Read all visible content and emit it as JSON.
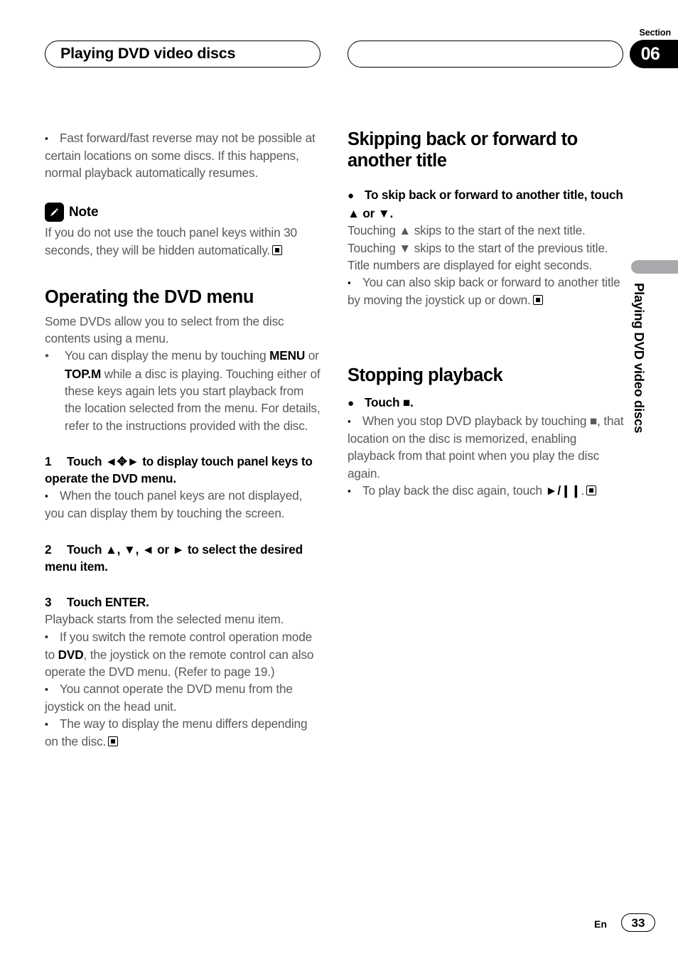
{
  "header": {
    "left_title": "Playing DVD video discs",
    "section_label": "Section",
    "section_number": "06"
  },
  "sidebar": {
    "vertical_title": "Playing DVD video discs"
  },
  "footer": {
    "language": "En",
    "page_number": "33"
  },
  "left_column": {
    "intro_note": {
      "marker": "▪",
      "text": "Fast forward/fast reverse may not be possible at certain locations on some discs. If this happens, normal playback automatically resumes."
    },
    "note_block": {
      "icon": "pencil-icon",
      "title": "Note",
      "text": "If you do not use the touch panel keys within 30 seconds, they will be hidden automatically."
    },
    "heading": "Operating the DVD menu",
    "intro": "Some DVDs allow you to select from the disc contents using a menu.",
    "bullet": {
      "marker": "•",
      "part1": "You can display the menu by touching ",
      "key1": "MENU",
      "conj": " or ",
      "key2": "TOP.M",
      "part2": " while a disc is playing. Touching either of these keys again lets you start playback from the location selected from the menu. For details, refer to the instructions provided with the disc."
    },
    "step1": {
      "number": "1",
      "text_before": "Touch ",
      "glyph": "◄✥►",
      "text_after": " to display touch panel keys to operate the DVD menu."
    },
    "step1_note": {
      "marker": "▪",
      "text": "When the touch panel keys are not displayed, you can display them by touching the screen."
    },
    "step2": {
      "number": "2",
      "text": "Touch ▲, ▼, ◄ or ► to select the desired menu item."
    },
    "step3": {
      "number": "3",
      "text": "Touch ENTER."
    },
    "step3_body": "Playback starts from the selected menu item.",
    "step3_note1": {
      "marker": "▪",
      "part1": "If you switch the remote control operation mode to ",
      "key": "DVD",
      "part2": ", the joystick on the remote control can also operate the DVD menu. (Refer to page 19.)"
    },
    "step3_note2": {
      "marker": "▪",
      "text": "You cannot operate the DVD menu from the joystick on the head unit."
    },
    "step3_note3": {
      "marker": "▪",
      "text": "The way to display the menu differs depending on the disc."
    }
  },
  "right_column": {
    "heading1": "Skipping back or forward to another title",
    "dot1": {
      "marker": "●",
      "text": "To skip back or forward to another title, touch ▲ or ▼."
    },
    "body1": "Touching ▲ skips to the start of the next title. Touching ▼ skips to the start of the previous title.",
    "body2": "Title numbers are displayed for eight seconds.",
    "note1": {
      "marker": "▪",
      "text": "You can also skip back or forward to another title by moving the joystick up or down."
    },
    "heading2": "Stopping playback",
    "dot2": {
      "marker": "●",
      "text": "Touch ■."
    },
    "note2": {
      "marker": "▪",
      "text": "When you stop DVD playback by touching ■, that location on the disc is memorized, enabling playback from that point when you play the disc again."
    },
    "note3": {
      "marker": "▪",
      "part1": "To play back the disc again, touch ",
      "glyph": "►/❙❙",
      "part2": "."
    }
  }
}
